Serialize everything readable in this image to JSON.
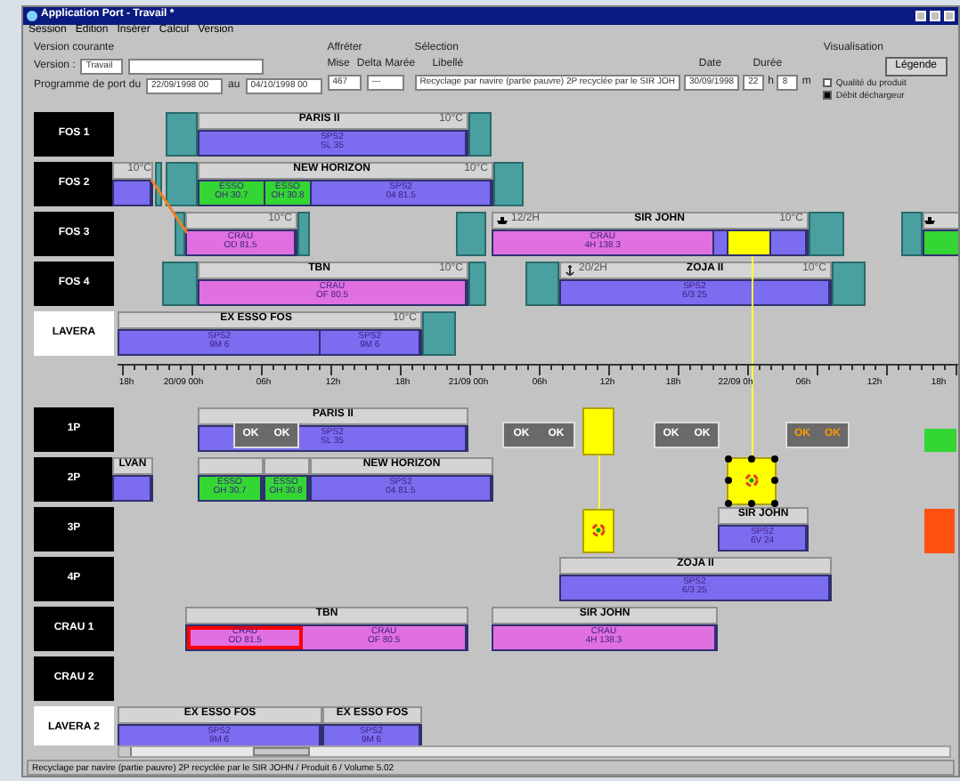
{
  "window": {
    "title": "Application Port - Travail *"
  },
  "menu": [
    "Session",
    "Edition",
    "Insérer",
    "Calcul",
    "Version"
  ],
  "version_group": {
    "title": "Version courante",
    "version_label": "Version :",
    "version": "Travail",
    "period_label": "Programme de port du",
    "start": "22/09/1998 00",
    "to_label": "au",
    "end": "04/10/1998 00"
  },
  "affreter_group": {
    "title": "Affréter",
    "col_1": "Mise",
    "col_2": "Delta Marée",
    "value_1": "467",
    "value_2": "---"
  },
  "selection": {
    "title": "Sélection",
    "label_heading": "Libellé",
    "label": "Recyclage par navire (partie pauvre) 2P recyclée par le SIR JOH",
    "date_heading": "Date",
    "date": "30/09/1998",
    "duration_heading": "Durée",
    "hours": "22",
    "hours_unit": "h",
    "minutes": "8",
    "minutes_unit": "m"
  },
  "visualisation": {
    "title": "Visualisation",
    "legend_button": "Légende",
    "options": [
      {
        "label": "Qualité du produit",
        "checked": false
      },
      {
        "label": "Débit déchargeur",
        "checked": true
      }
    ]
  },
  "berths": [
    {
      "label": "FOS 1",
      "kind": "berth"
    },
    {
      "label": "FOS 2",
      "kind": "berth"
    },
    {
      "label": "FOS 3",
      "kind": "berth"
    },
    {
      "label": "FOS 4",
      "kind": "berth"
    },
    {
      "label": "LAVERA",
      "kind": "external"
    }
  ],
  "ships": [
    {
      "name": "PARIS II",
      "temp": "10°C",
      "segments": [
        {
          "color": "#7b6cf0",
          "lines": [
            "SPS2",
            "SL 35"
          ]
        }
      ]
    },
    {
      "temp": "10°C",
      "segments": [
        {
          "color": "#7b6cf0"
        }
      ]
    },
    {
      "name": "NEW HORIZON",
      "temp": "10°C",
      "segments": [
        {
          "color": "#33d633",
          "lines": [
            "ESSO",
            "OH 30.7"
          ]
        },
        {
          "color": "#33d633",
          "lines": [
            "ESSO",
            "OH 30.8"
          ]
        },
        {
          "color": "#7b6cf0",
          "lines": [
            "SPS2",
            "04 81.5"
          ]
        }
      ]
    },
    {
      "temp": "10°C",
      "segments": [
        {
          "color": "#e070e0",
          "lines": [
            "CRAU",
            "OD 81.5"
          ]
        }
      ]
    },
    {
      "name": "SIR JOHN",
      "arrival": "12/2H",
      "kind": "ship",
      "temp": "10°C",
      "segments": [
        {
          "color": "#e070e0",
          "lines": [
            "CRAU",
            "4H 138.3"
          ]
        },
        {
          "color": "#7b6cf0"
        },
        {
          "color": "#ffff00"
        },
        {
          "color": "#7b6cf0"
        }
      ]
    },
    {
      "kind": "ship",
      "segments": [
        {
          "color": "#33d633"
        }
      ]
    },
    {
      "name": "TBN",
      "temp": "10°C",
      "segments": [
        {
          "color": "#e070e0",
          "lines": [
            "CRAU",
            "OF 80.5"
          ]
        }
      ]
    },
    {
      "name": "ZOJA II",
      "arrival": "20/2H",
      "kind": "anchored",
      "temp": "10°C",
      "segments": [
        {
          "color": "#7b6cf0",
          "lines": [
            "SPS2",
            "6/3 25"
          ]
        }
      ]
    },
    {
      "name": "EX ESSO FOS",
      "temp": "10°C",
      "segments": [
        {
          "color": "#7b6cf0",
          "lines": [
            "SPS2",
            "9M 6"
          ]
        },
        {
          "color": "#7b6cf0",
          "lines": [
            "SPS2",
            "9M 6"
          ]
        }
      ]
    }
  ],
  "axis_labels": [
    "18h",
    "20/09 00h",
    "06h",
    "12h",
    "18h",
    "21/09 00h",
    "06h",
    "12h",
    "18h",
    "22/09 0h",
    "06h",
    "12h",
    "18h"
  ],
  "tanks": [
    {
      "label": "1P",
      "kind": "tank"
    },
    {
      "label": "2P",
      "kind": "tank"
    },
    {
      "label": "3P",
      "kind": "tank"
    },
    {
      "label": "4P",
      "kind": "tank"
    },
    {
      "label": "CRAU 1",
      "kind": "tank"
    },
    {
      "label": "CRAU 2",
      "kind": "tank"
    },
    {
      "label": "LAVERA 2",
      "kind": "external"
    }
  ],
  "tank_bars": [
    {
      "name": "PARIS II",
      "segments": [
        {
          "color": "#7b6cf0",
          "lines": [
            "SPS2",
            "SL 35"
          ],
          "selected": false
        }
      ]
    },
    {
      "name": "LVAN",
      "segments": [
        {
          "color": "#7b6cf0",
          "selected": false
        }
      ]
    },
    {
      "segments": [
        {
          "color": "#33d633",
          "lines": [
            "ESSO",
            "OH 30.7"
          ],
          "selected": false
        }
      ]
    },
    {
      "segments": [
        {
          "color": "#33d633",
          "lines": [
            "ESSO",
            "OH 30.8"
          ],
          "selected": false
        }
      ]
    },
    {
      "name": "NEW HORIZON",
      "segments": [
        {
          "color": "#7b6cf0",
          "lines": [
            "SPS2",
            "04 81.5"
          ],
          "selected": false
        }
      ]
    },
    {
      "name": "SIR JOHN",
      "segments": [
        {
          "color": "#7b6cf0",
          "lines": [
            "SPS2",
            "6V 24"
          ],
          "selected": false
        }
      ]
    },
    {
      "name": "ZOJA II",
      "segments": [
        {
          "color": "#7b6cf0",
          "lines": [
            "SPS2",
            "6/3 25"
          ],
          "selected": false
        }
      ]
    },
    {
      "name": "TBN",
      "segments": [
        {
          "color": "#e070e0",
          "lines": [
            "CRAU",
            "OD 81.5"
          ],
          "selected": true
        },
        {
          "color": "#e070e0",
          "lines": [
            "CRAU",
            "OF 80.5"
          ],
          "selected": false
        }
      ]
    },
    {
      "name": "SIR JOHN",
      "segments": [
        {
          "color": "#e070e0",
          "lines": [
            "CRAU",
            "4H 138.3"
          ],
          "selected": false
        }
      ]
    },
    {
      "name": "EX ESSO FOS",
      "segments": [
        {
          "color": "#7b6cf0",
          "lines": [
            "SPS2",
            "9M 6"
          ],
          "selected": false
        }
      ]
    },
    {
      "name": "EX ESSO FOS",
      "segments": [
        {
          "color": "#7b6cf0",
          "lines": [
            "SPS2",
            "9M 6"
          ],
          "selected": false
        }
      ]
    }
  ],
  "events": [
    {
      "kind": "check",
      "labels": [
        "OK",
        "OK"
      ],
      "color": "#ffffff"
    },
    {
      "kind": "check",
      "labels": [
        "OK",
        "OK"
      ],
      "color": "#ffffff"
    },
    {
      "kind": "check",
      "labels": [
        "OK",
        "OK"
      ],
      "color": "#ffffff"
    },
    {
      "kind": "check",
      "labels": [
        "OK",
        "OK"
      ],
      "color": "#ff9900"
    },
    {
      "kind": "operation",
      "icon": false,
      "selected": false
    },
    {
      "kind": "operation",
      "icon": true,
      "selected": true
    },
    {
      "kind": "operation",
      "icon": true,
      "selected": false
    },
    {
      "kind": "block",
      "color": "#33d633"
    },
    {
      "kind": "block",
      "color": "#ff5010"
    }
  ],
  "status_bar": "Recyclage par navire (partie pauvre) 2P recyclée par le SIR JOHN / Produit 6 / Volume 5.02"
}
